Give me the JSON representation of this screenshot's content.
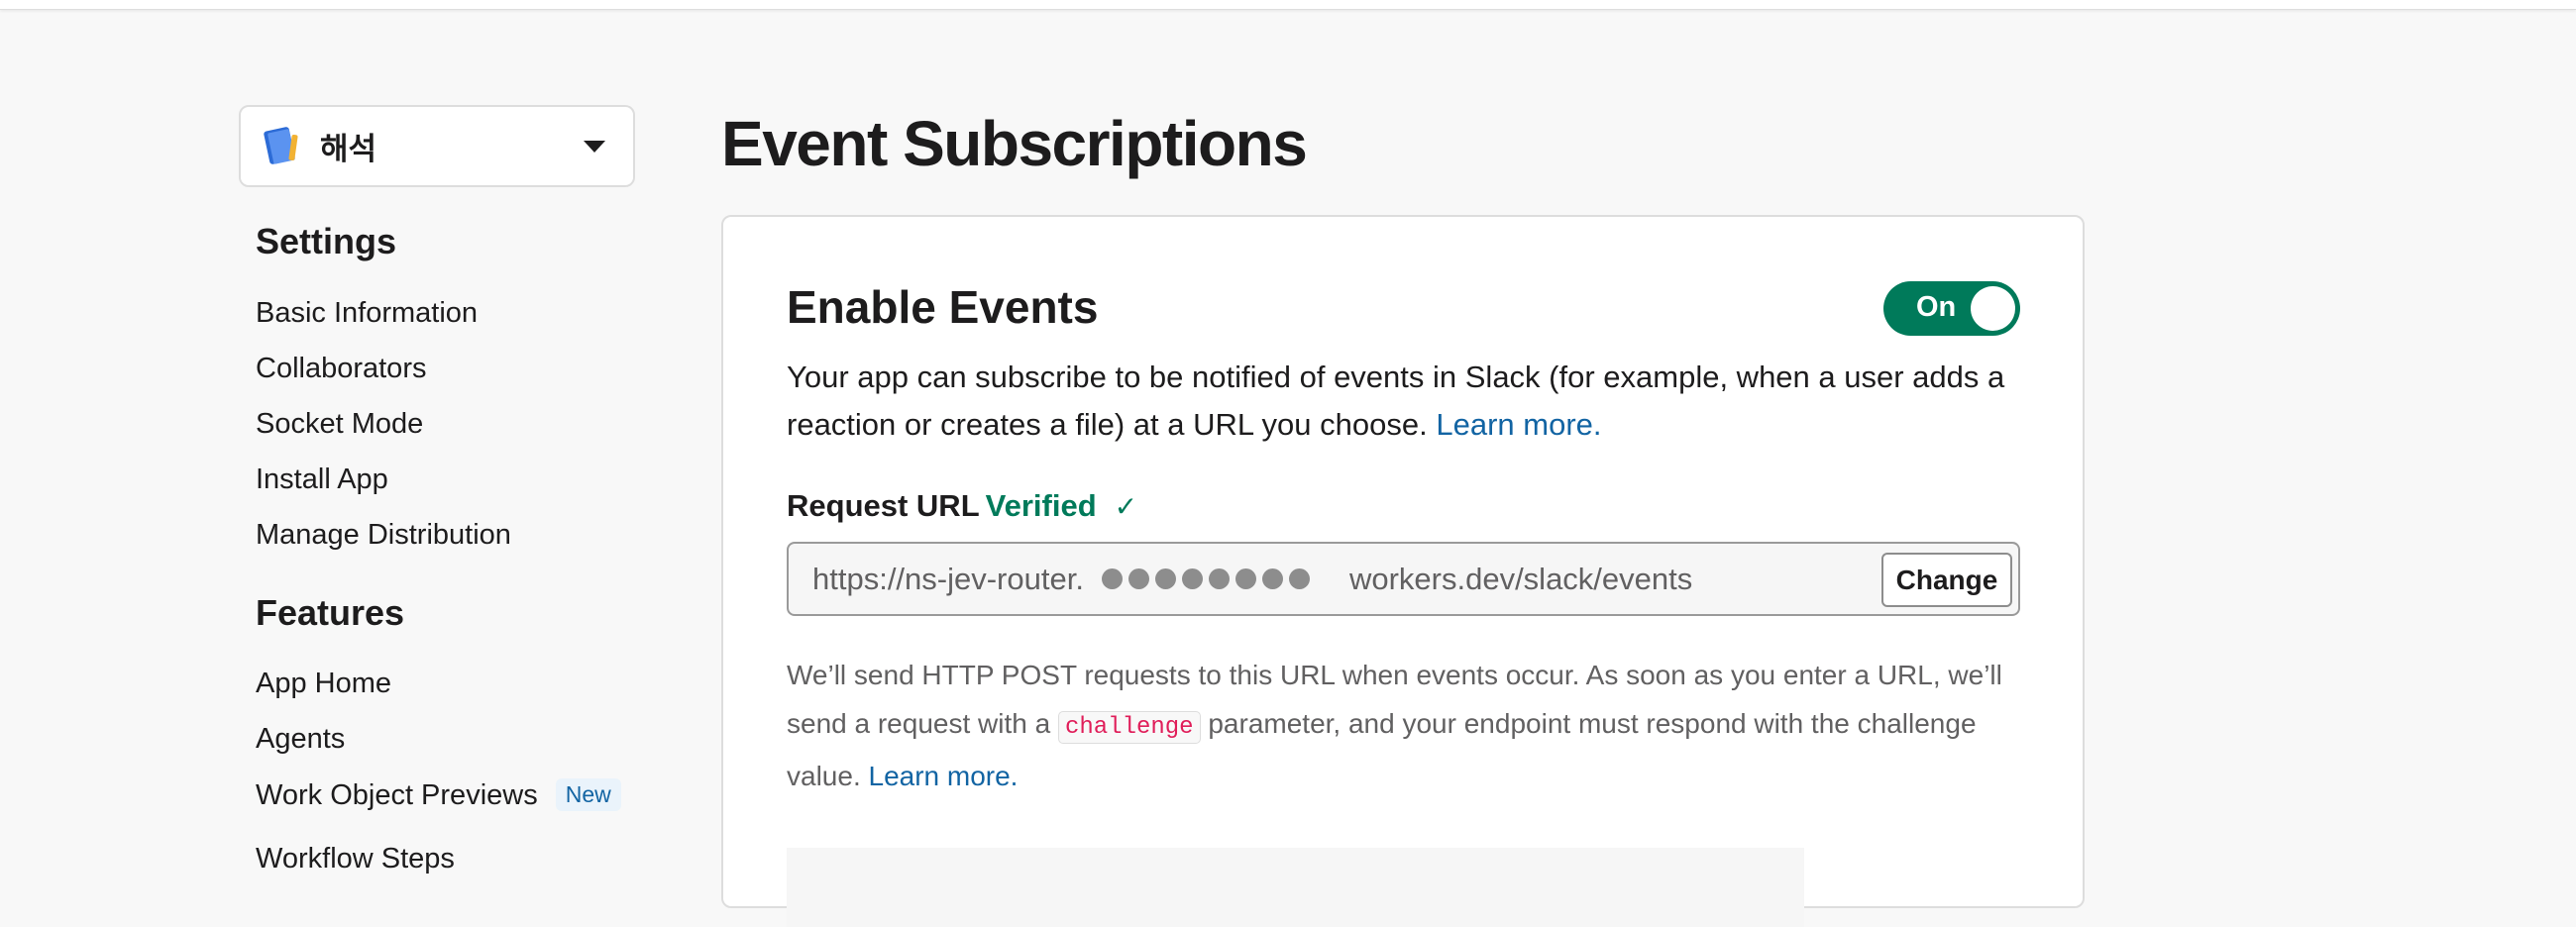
{
  "app_switcher": {
    "name": "해석"
  },
  "sidebar": {
    "settings_heading": "Settings",
    "settings_items": [
      {
        "label": "Basic Information"
      },
      {
        "label": "Collaborators"
      },
      {
        "label": "Socket Mode"
      },
      {
        "label": "Install App"
      },
      {
        "label": "Manage Distribution"
      }
    ],
    "features_heading": "Features",
    "features_items": [
      {
        "label": "App Home"
      },
      {
        "label": "Agents"
      },
      {
        "label": "Work Object Previews",
        "badge": "New"
      },
      {
        "label": "Workflow Steps"
      }
    ]
  },
  "main": {
    "page_title": "Event Subscriptions",
    "enable_events": {
      "title": "Enable Events",
      "toggle_label": "On",
      "toggle_state": true,
      "description": "Your app can subscribe to be notified of events in Slack (for example, when a user adds a reaction or creates a file) at a URL you choose.",
      "learn_more": "Learn more."
    },
    "request_url": {
      "label": "Request URL",
      "status": "Verified",
      "status_icon": "check-icon",
      "url_prefix": "https://ns-jev-router.",
      "url_suffix": "workers.dev/slack/events",
      "change_button": "Change"
    },
    "help": {
      "text_before": "We’ll send HTTP POST requests to this URL when events occur. As soon as you enter a URL, we’ll send a request with a",
      "code": "challenge",
      "text_after": "parameter, and your endpoint must respond with the challenge value.",
      "learn_more": "Learn more."
    }
  },
  "colors": {
    "accent_green": "#007a5a",
    "link_blue": "#1264a3",
    "code_red": "#e01e5a",
    "background": "#f8f8f8"
  }
}
